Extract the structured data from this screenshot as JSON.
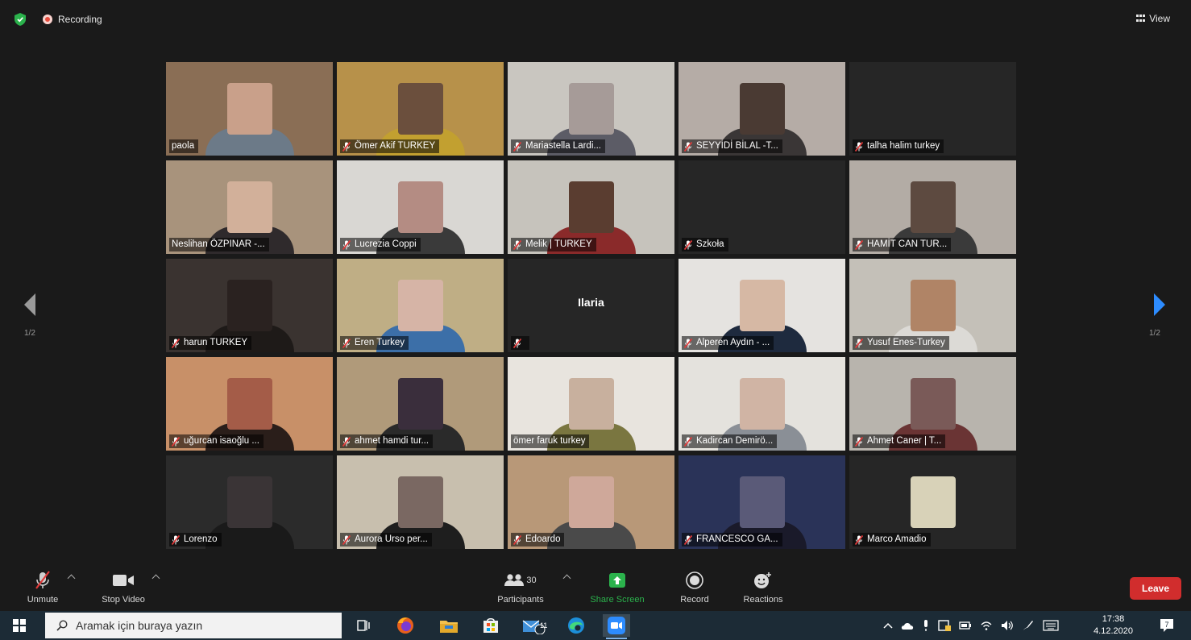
{
  "topbar": {
    "recording_label": "Recording",
    "view_label": "View"
  },
  "tiles": [
    {
      "name": "paola",
      "muted": false,
      "active": true,
      "bg": "#8a6e55",
      "face": "#c9a08a",
      "body": "#6c7a88"
    },
    {
      "name": "Ömer Akif TURKEY",
      "muted": true,
      "bg": "#b7914a",
      "face": "#6b4f3d",
      "body": "#c2a030"
    },
    {
      "name": "Mariastella Lardi...",
      "muted": true,
      "bg": "#c9c6c0",
      "face": "#a69b98",
      "body": "#5c5c66"
    },
    {
      "name": "SEYYİDİ BİLAL -T...",
      "muted": true,
      "bg": "#b5aca6",
      "face": "#4a3a33",
      "body": "#3a3636"
    },
    {
      "name": "talha halim turkey",
      "muted": true,
      "bg": "#262626",
      "face": "",
      "body": ""
    },
    {
      "name": "Neslihan ÖZPINAR -...",
      "muted": false,
      "bg": "#a8937c",
      "face": "#d2b09a",
      "body": "#2f2a2c"
    },
    {
      "name": "Lucrezia Coppi",
      "muted": true,
      "bg": "#d9d7d3",
      "face": "#b48c83",
      "body": "#3a3a3a"
    },
    {
      "name": "Melik | TURKEY",
      "muted": true,
      "bg": "#c6c3bc",
      "face": "#5a3d30",
      "body": "#8a2a2a"
    },
    {
      "name": "Szkoła",
      "muted": true,
      "bg": "#262626",
      "face": "",
      "body": ""
    },
    {
      "name": "HAMİT CAN TUR...",
      "muted": true,
      "bg": "#b3aca5",
      "face": "#5d4a40",
      "body": "#3a3a3a"
    },
    {
      "name": "harun TURKEY",
      "muted": true,
      "bg": "#3a3330",
      "face": "#2a2220",
      "body": "#1e1a18"
    },
    {
      "name": "Eren Turkey",
      "muted": true,
      "bg": "#bfae85",
      "face": "#d6b4a6",
      "body": "#3c6fa8"
    },
    {
      "name": "",
      "center": "Ilaria",
      "muted": true,
      "bg": "#262626",
      "face": "",
      "body": ""
    },
    {
      "name": "Alperen Aydın - ...",
      "muted": true,
      "bg": "#e5e3e0",
      "face": "#d6b8a4",
      "body": "#1e2a3e"
    },
    {
      "name": "Yusuf Enes-Turkey",
      "muted": true,
      "bg": "#c4c0b8",
      "face": "#b08466",
      "body": "#dcdad6"
    },
    {
      "name": "uğurcan isaoğlu ...",
      "muted": true,
      "bg": "#c89068",
      "face": "#a45c48",
      "body": "#2a1e1a"
    },
    {
      "name": "ahmet hamdi tur...",
      "muted": true,
      "bg": "#b09a7a",
      "face": "#3a2e3c",
      "body": "#2a2a2a"
    },
    {
      "name": "ömer faruk turkey",
      "muted": false,
      "bg": "#e8e4de",
      "face": "#c8b09e",
      "body": "#7a7640"
    },
    {
      "name": "Kadircan Demirö...",
      "muted": true,
      "bg": "#e4e2dd",
      "face": "#d0b4a4",
      "body": "#8a8f96"
    },
    {
      "name": "Ahmet Caner | T...",
      "muted": true,
      "bg": "#b8b4ad",
      "face": "#7a5a58",
      "body": "#6a3434"
    },
    {
      "name": "Lorenzo",
      "muted": true,
      "bg": "#2b2b2b",
      "face": "#3a3436",
      "body": "#1a1a1a"
    },
    {
      "name": "Aurora Urso per...",
      "muted": true,
      "bg": "#c8bfae",
      "face": "#7a6862",
      "body": "#1e1e1e"
    },
    {
      "name": "Edoardo",
      "muted": true,
      "bg": "#b89878",
      "face": "#cfa89a",
      "body": "#4a4a4a"
    },
    {
      "name": "FRANCESCO GA...",
      "muted": true,
      "bg": "#2a3358",
      "face": "#5a5a78",
      "body": "#1a1a2a"
    },
    {
      "name": "Marco Amadio",
      "muted": true,
      "bg": "#262626",
      "face": "#d8d2b8",
      "body": ""
    }
  ],
  "pager": {
    "left_label": "1/2",
    "right_label": "1/2"
  },
  "toolbar": {
    "unmute_label": "Unmute",
    "stop_video_label": "Stop Video",
    "participants_label": "Participants",
    "participants_count": "30",
    "share_screen_label": "Share Screen",
    "record_label": "Record",
    "reactions_label": "Reactions",
    "leave_label": "Leave"
  },
  "taskbar": {
    "search_placeholder": "Aramak için buraya yazın",
    "mail_badge": "11",
    "time": "17:38",
    "date": "4.12.2020",
    "notification_count": "7"
  },
  "colors": {
    "accent_green": "#2bb24c",
    "leave_red": "#d12d2d",
    "active_speaker": "#c4e06a",
    "pager_blue": "#2d8cff"
  }
}
